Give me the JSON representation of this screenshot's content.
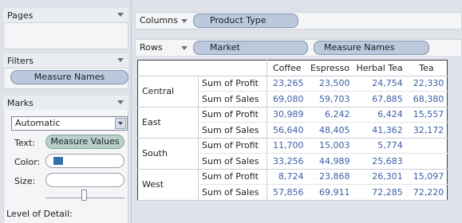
{
  "pages": {
    "title": "Pages"
  },
  "filters": {
    "title": "Filters",
    "pills": [
      "Measure Names"
    ]
  },
  "marks": {
    "title": "Marks",
    "mark_type": "Automatic",
    "text_label": "Text:",
    "text_pill": "Measure Values",
    "color_label": "Color:",
    "color_swatch": "#3a6ea8",
    "size_label": "Size:",
    "size_level": 0.55,
    "level_of_detail_label": "Level of Detail:"
  },
  "columns_shelf": {
    "label": "Columns",
    "pill": "Product Type"
  },
  "rows_shelf": {
    "label": "Rows",
    "pills": [
      "Market",
      "Measure Names"
    ]
  },
  "table": {
    "columns": [
      "Coffee",
      "Espresso",
      "Herbal Tea",
      "Tea"
    ],
    "groups": [
      {
        "market": "Central",
        "rows": [
          {
            "measure": "Sum of Profit",
            "values": [
              "23,265",
              "23,500",
              "24,754",
              "22,330"
            ]
          },
          {
            "measure": "Sum of Sales",
            "values": [
              "69,080",
              "59,703",
              "67,885",
              "68,380"
            ]
          }
        ]
      },
      {
        "market": "East",
        "rows": [
          {
            "measure": "Sum of Profit",
            "values": [
              "30,989",
              "6,242",
              "6,424",
              "15,557"
            ]
          },
          {
            "measure": "Sum of Sales",
            "values": [
              "56,640",
              "48,405",
              "41,362",
              "32,172"
            ]
          }
        ]
      },
      {
        "market": "South",
        "rows": [
          {
            "measure": "Sum of Profit",
            "values": [
              "11,700",
              "15,003",
              "5,774",
              ""
            ]
          },
          {
            "measure": "Sum of Sales",
            "values": [
              "33,256",
              "44,989",
              "25,683",
              ""
            ]
          }
        ]
      },
      {
        "market": "West",
        "rows": [
          {
            "measure": "Sum of Profit",
            "values": [
              "8,724",
              "23,868",
              "26,301",
              "15,097"
            ]
          },
          {
            "measure": "Sum of Sales",
            "values": [
              "57,856",
              "69,911",
              "72,285",
              "72,220"
            ]
          }
        ]
      }
    ]
  }
}
